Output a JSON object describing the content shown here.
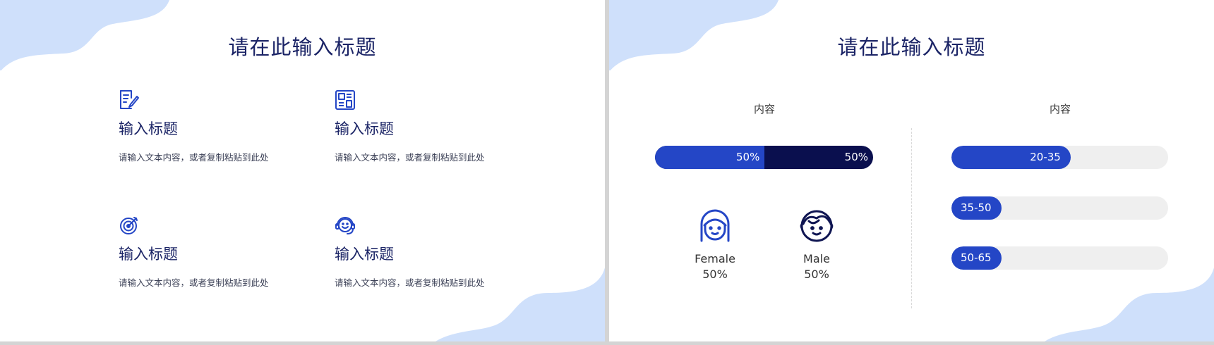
{
  "colors": {
    "navy": "#1b2466",
    "accent": "#2446c6",
    "dark_segment": "#0a0f4e",
    "blob": "#cfe0fb",
    "track": "#efefef"
  },
  "slide1": {
    "title": "请在此输入标题",
    "items": [
      {
        "icon": "document-edit-icon",
        "title": "输入标题",
        "desc": "请输入文本内容，或者复制粘贴到此处"
      },
      {
        "icon": "layout-panels-icon",
        "title": "输入标题",
        "desc": "请输入文本内容，或者复制粘贴到此处"
      },
      {
        "icon": "target-icon",
        "title": "输入标题",
        "desc": "请输入文本内容，或者复制粘贴到此处"
      },
      {
        "icon": "headset-support-icon",
        "title": "输入标题",
        "desc": "请输入文本内容，或者复制粘贴到此处"
      }
    ]
  },
  "slide2": {
    "title": "请在此输入标题",
    "left_label": "内容",
    "right_label": "内容",
    "gender_bar": {
      "female_pct": 50,
      "male_pct": 50,
      "female_label": "50%",
      "male_label": "50%"
    },
    "people": [
      {
        "icon": "female-avatar-icon",
        "name": "Female",
        "pct": "50%"
      },
      {
        "icon": "male-avatar-icon",
        "name": "Male",
        "pct": "50%"
      }
    ],
    "age_ranges": [
      {
        "label": "20-35",
        "fraction": 0.55
      },
      {
        "label": "35-50",
        "fraction": 0.23
      },
      {
        "label": "50-65",
        "fraction": 0.23
      }
    ]
  }
}
